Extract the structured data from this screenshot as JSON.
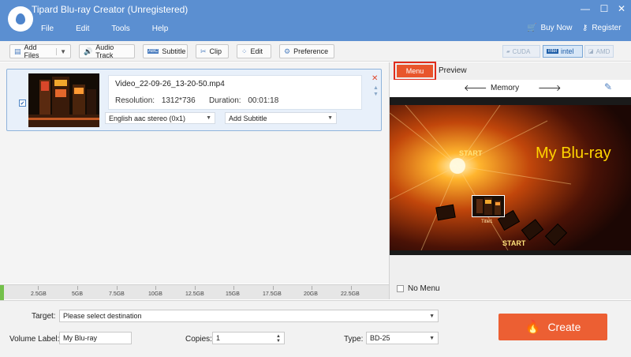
{
  "window": {
    "title": "Tipard Blu-ray Creator (Unregistered)",
    "controls": [
      "—",
      "☐",
      "✕"
    ]
  },
  "menu": [
    "File",
    "Edit",
    "Tools",
    "Help"
  ],
  "header_links": {
    "buy": "Buy Now",
    "register": "Register"
  },
  "toolbar": {
    "add_files": "Add Files",
    "audio_track": "Audio Track",
    "subtitle": "Subtitle",
    "clip": "Clip",
    "edit": "Edit",
    "preference": "Preference",
    "hw": [
      {
        "label": "CUDA",
        "badge": "nVIDIA"
      },
      {
        "label": "intel",
        "badge": "intel"
      },
      {
        "label": "AMD",
        "badge": "AMD"
      }
    ]
  },
  "file": {
    "name": "Video_22-09-26_13-20-50.mp4",
    "resolution_label": "Resolution:",
    "resolution": "1312*736",
    "duration_label": "Duration:",
    "duration": "00:01:18",
    "audio": "English aac stereo (0x1)",
    "subtitle": "Add Subtitle"
  },
  "capacity": {
    "ticks": [
      "2.5GB",
      "5GB",
      "7.5GB",
      "10GB",
      "12.5GB",
      "15GB",
      "17.5GB",
      "20GB",
      "22.5GB"
    ]
  },
  "panel": {
    "tab_menu": "Menu",
    "tab_preview": "Preview",
    "template": "Memory",
    "preview_title": "My Blu-ray",
    "start1": "START",
    "start2": "START",
    "title1": "Title1",
    "no_menu": "No Menu"
  },
  "bottom": {
    "target_label": "Target:",
    "target_value": "Please select destination",
    "volume_label": "Volume Label:",
    "volume_value": "My Blu-ray",
    "copies_label": "Copies:",
    "copies_value": "1",
    "type_label": "Type:",
    "type_value": "BD-25",
    "create": "Create"
  },
  "colors": {
    "titlebar": "#5b8fd1",
    "accent": "#ec5f33",
    "menu_tab": "#e8552c"
  }
}
